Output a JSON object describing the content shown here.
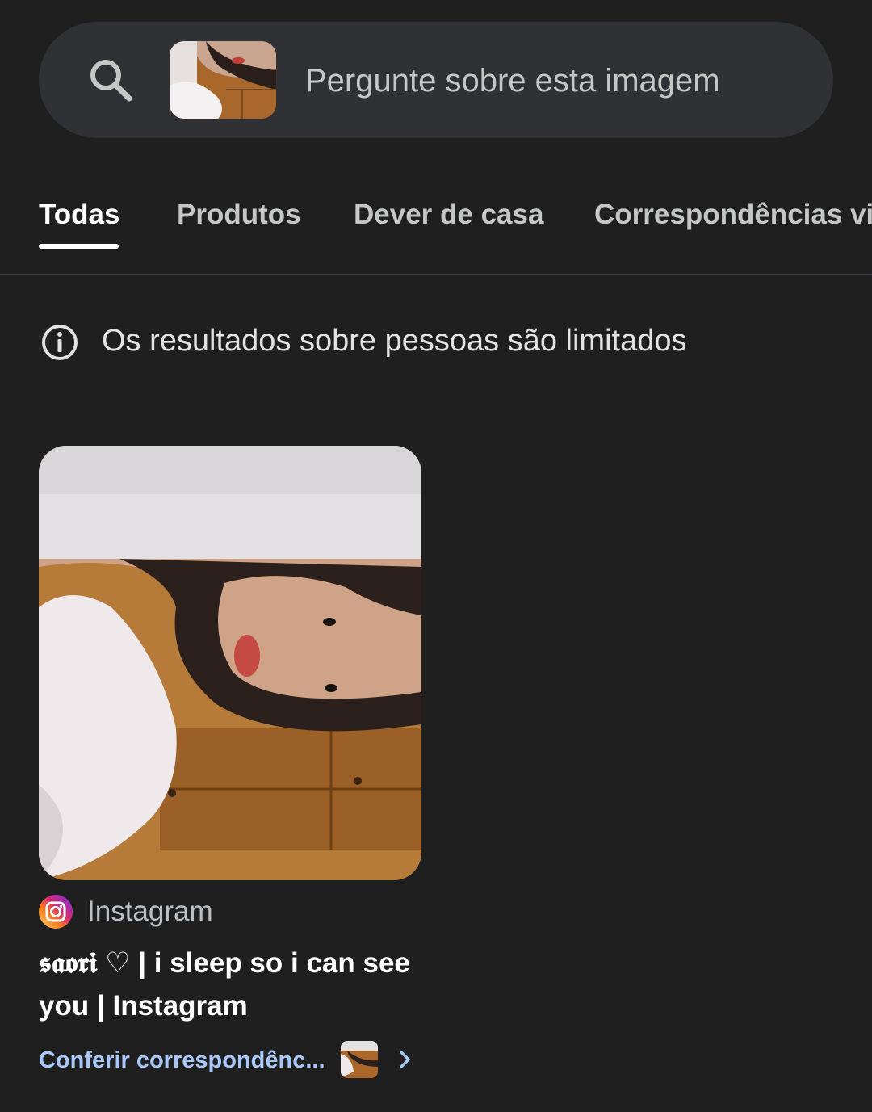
{
  "search": {
    "placeholder": "Pergunte sobre esta imagem",
    "icon": "search-icon"
  },
  "tabs": [
    {
      "label": "Todas",
      "active": true
    },
    {
      "label": "Produtos",
      "active": false
    },
    {
      "label": "Dever de casa",
      "active": false
    },
    {
      "label": "Correspondências vis",
      "active": false
    }
  ],
  "notice": {
    "icon": "info-icon",
    "text": "Os resultados sobre pessoas são limitados"
  },
  "results": [
    {
      "source": "Instagram",
      "source_icon": "instagram-icon",
      "title": "𝖘𝖆𝖔𝖗𝖎 ♡ | i sleep so i can see you | Instagram",
      "link": "Conferir correspondênc..."
    }
  ],
  "colors": {
    "background": "#1f1f1f",
    "searchbar": "#303134",
    "link": "#a8c7fa"
  }
}
